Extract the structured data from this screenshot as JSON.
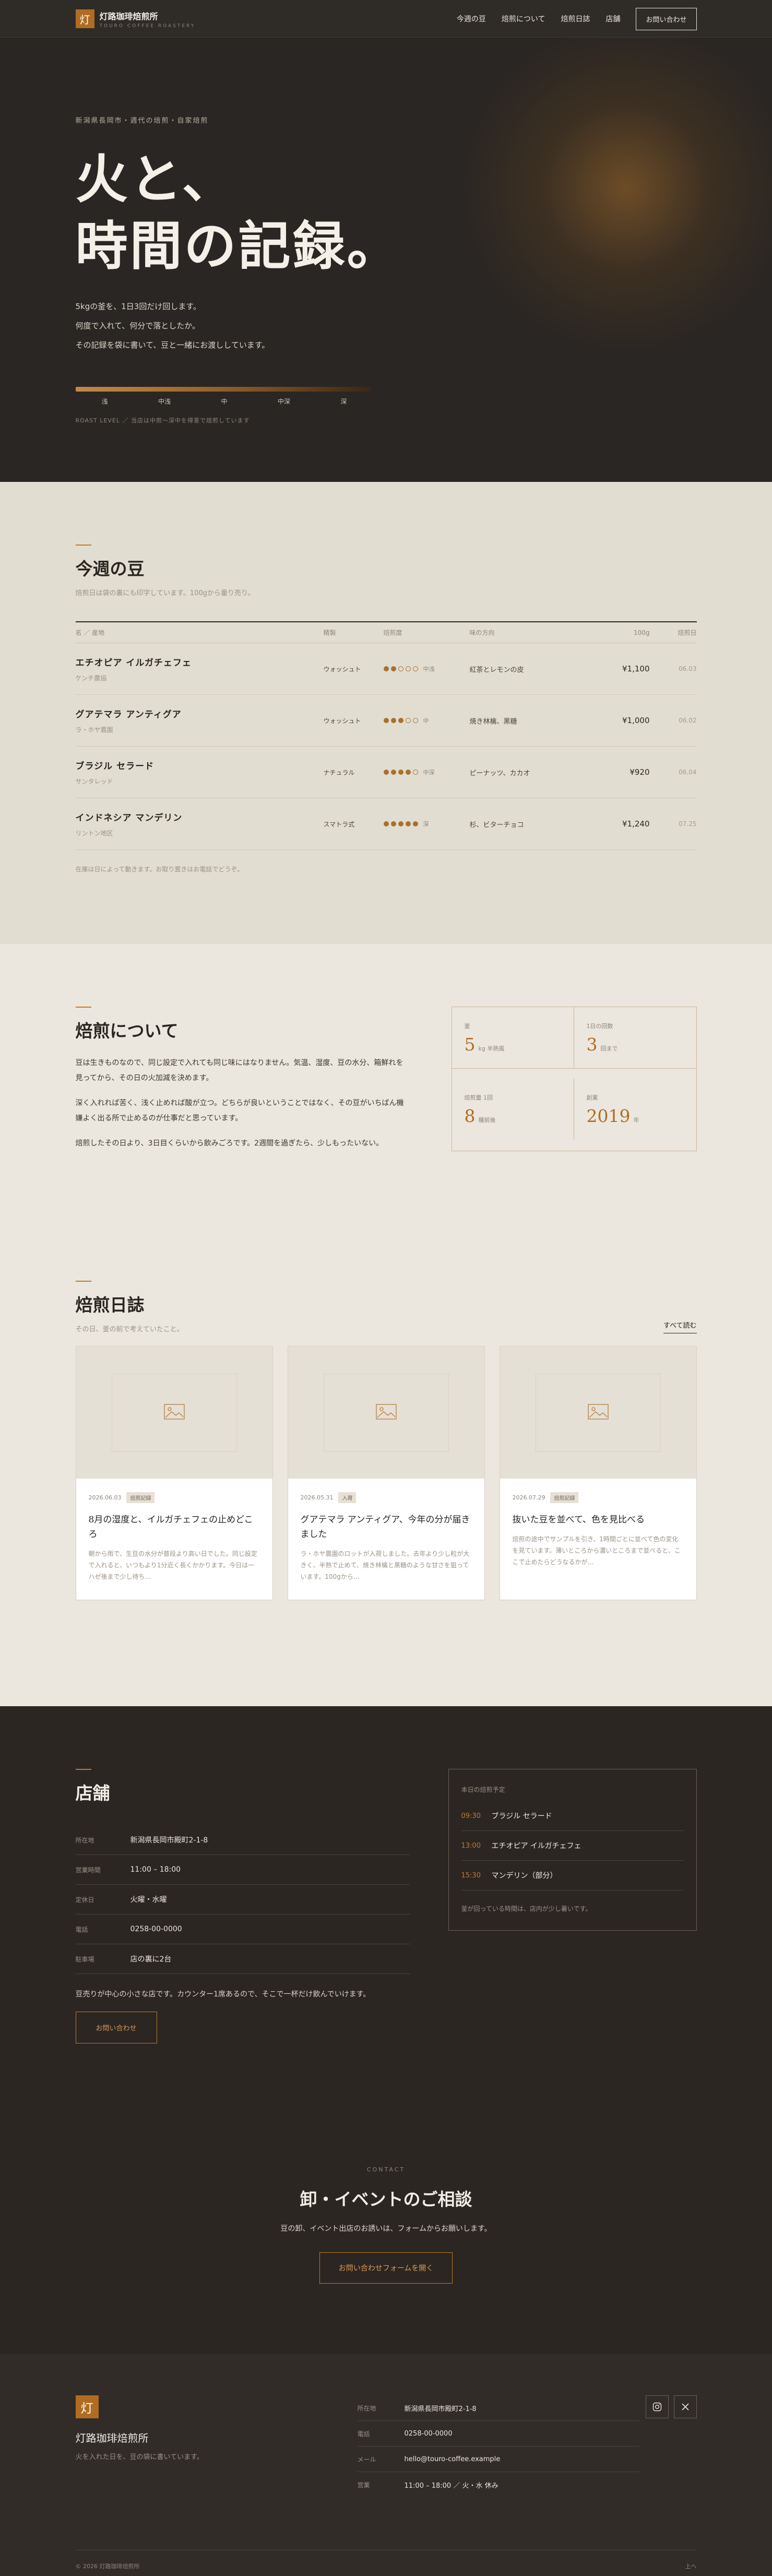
{
  "nav": {
    "logo_mark": "灯",
    "brand_jp": "灯路珈琲焙煎所",
    "brand_en": "TOURO COFFEE ROASTERY",
    "links": [
      "今週の豆",
      "焙煎について",
      "焙煎日誌",
      "店舗"
    ],
    "cta": "お問い合わせ"
  },
  "hero": {
    "eyebrow": "新潟県長岡市・週代の焙煎・自家焙煎",
    "title_line1": "火と、",
    "title_line2": "時間の記録。",
    "body": [
      "5kgの釜を、1日3回だけ回します。",
      "何度で入れて、何分で落としたか。",
      "その記録を袋に書いて、豆と一緒にお渡ししています。"
    ],
    "roast_levels": [
      "浅",
      "中浅",
      "中",
      "中深",
      "深"
    ],
    "caption": "ROAST LEVEL ／ 当店は中煎〜深中を得意で焙煎しています"
  },
  "beans": {
    "title": "今週の豆",
    "subtitle": "焙煎日は袋の裏にも印字しています。100gから量り売り。",
    "columns": [
      "名 ／ 産地",
      "精製",
      "焙煎度",
      "味の方向",
      "100g",
      "焙煎日"
    ],
    "rows": [
      {
        "name": "エチオピア イルガチェフェ",
        "origin": "ケンチ農協",
        "process": "ウォッシュト",
        "roast": 2,
        "roast_label": "中浅",
        "flavor": "紅茶とレモンの皮",
        "price": "¥1,100",
        "date": "06.03"
      },
      {
        "name": "グアテマラ アンティグア",
        "origin": "ラ・ホヤ農園",
        "process": "ウォッシュト",
        "roast": 3,
        "roast_label": "中",
        "flavor": "焼き林檎、黒糖",
        "price": "¥1,000",
        "date": "06.02"
      },
      {
        "name": "ブラジル セラード",
        "origin": "サンタレッド",
        "process": "ナチュラル",
        "roast": 4,
        "roast_label": "中深",
        "flavor": "ピーナッツ、カカオ",
        "price": "¥920",
        "date": "06.04"
      },
      {
        "name": "インドネシア マンデリン",
        "origin": "リントン地区",
        "process": "スマトラ式",
        "roast": 5,
        "roast_label": "深",
        "flavor": "杉、ビターチョコ",
        "price": "¥1,240",
        "date": "07.25"
      }
    ],
    "note": "在庫は日によって動きます。お取り置きはお電話でどうぞ。"
  },
  "about": {
    "title": "焙煎について",
    "paragraphs": [
      "豆は生きものなので、同じ設定で入れても同じ味にはなりません。気温、湿度、豆の水分、箱鮮れを見ってから、その日の火加減を決めます。",
      "深く入れれば苦く、浅く止めれば酸が立つ。どちらが良いということではなく、その豆がいちばん機嫌よく出る所で止めるのが仕事だと思っています。",
      "焙煎したその日より、3日目くらいから飲みごろです。2週間を過ぎたら、少しもったいない。"
    ],
    "stats": [
      {
        "label": "釜",
        "num": "5",
        "unit": "kg 半熱風"
      },
      {
        "label": "1日の回数",
        "num": "3",
        "unit": "回まで"
      },
      {
        "label": "焙煎量 1回",
        "num": "8",
        "unit": "種前後"
      },
      {
        "label": "創業",
        "num": "2019",
        "unit": "年"
      }
    ]
  },
  "journal": {
    "title": "焙煎日誌",
    "subtitle": "その日、釜の前で考えていたこと。",
    "more": "すべて読む",
    "cards": [
      {
        "date": "2026.06.03",
        "tag": "焙煎記録",
        "title": "8月の湿度と、イルガチェフェの止めどころ",
        "text": "朝から雨で、生豆の水分が普段より高い日でした。同じ設定で入れると、いつもより1分近く長くかかります。今日は一ハゼ後まで少し待ち…"
      },
      {
        "date": "2026.05.31",
        "tag": "入荷",
        "title": "グアテマラ アンティグア、今年の分が届きました",
        "text": "ラ・ホヤ農園のロットが入荷しました。去年より少し粒が大きく、半熟で止めて、焼き林檎と黒糖のような甘さを狙っています。100gから…"
      },
      {
        "date": "2026.07.29",
        "tag": "焙煎記録",
        "title": "抜いた豆を並べて、色を見比べる",
        "text": "焙煎の途中でサンプルを引き、1時間ごとに並べて色の変化を見ています。薄いところから濃いところまで並べると、ここで止めたらどうなるかが…"
      }
    ]
  },
  "shop": {
    "title": "店舗",
    "rows": [
      {
        "k": "所在地",
        "v": "新潟県長岡市殿町2-1-8"
      },
      {
        "k": "営業時間",
        "v": "11:00 – 18:00"
      },
      {
        "k": "定休日",
        "v": "火曜・水曜"
      },
      {
        "k": "電話",
        "v": "0258-00-0000"
      },
      {
        "k": "駐車場",
        "v": "店の裏に2台"
      }
    ],
    "note": "豆売りが中心の小さな店です。カウンター1席あるので、そこで一杯だけ飲んでいけます。",
    "button": "お問い合わせ",
    "schedule_title": "本日の焙煎予定",
    "schedule": [
      {
        "time": "09:30",
        "name": "ブラジル セラード"
      },
      {
        "time": "13:00",
        "name": "エチオピア イルガチェフェ"
      },
      {
        "time": "15:30",
        "name": "マンデリン（部分）"
      }
    ],
    "schedule_note": "釜が回っている時間は、店内が少し暑いです。"
  },
  "contact": {
    "label": "CONTACT",
    "title": "卸・イベントのご相談",
    "body": "豆の卸、イベント出店のお誘いは、フォームからお願いします。",
    "button": "お問い合わせフォームを開く"
  },
  "footer": {
    "logo_mark": "灯",
    "name": "灯路珈琲焙煎所",
    "desc": "火を入れた日を、豆の袋に書いています。",
    "rows": [
      {
        "k": "所在地",
        "v": "新潟県長岡市殿町2-1-8"
      },
      {
        "k": "電話",
        "v": "0258-00-0000"
      },
      {
        "k": "メール",
        "v": "hello@touro-coffee.example"
      },
      {
        "k": "営業",
        "v": "11:00 – 18:00 ／ 火・水 休み"
      }
    ],
    "copyright": "© 2026 灯路珈琲焙煎所",
    "top_link": "上へ"
  },
  "colors": {
    "accent": "#b06c22",
    "dark": "#2b2622",
    "paper": "#ebe7de"
  }
}
